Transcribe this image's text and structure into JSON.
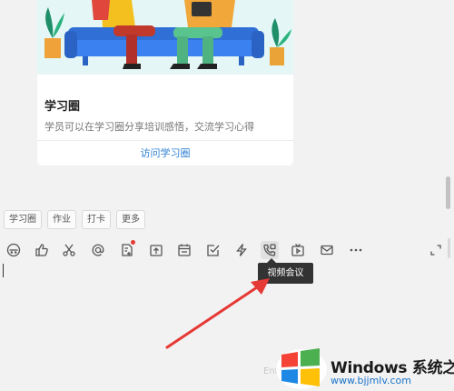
{
  "card": {
    "title": "学习圈",
    "description": "学员可以在学习圈分享培训感悟，交流学习心得",
    "link": "访问学习圈"
  },
  "tags": [
    "学习圈",
    "作业",
    "打卡",
    "更多"
  ],
  "toolbar": {
    "icons": [
      "robot-face-icon",
      "thumbs-up-icon",
      "scissors-icon",
      "at-sign-icon",
      "document-add-icon",
      "upload-box-icon",
      "calendar-icon",
      "checkbox-icon",
      "lightning-icon",
      "video-conference-icon",
      "live-video-icon",
      "mail-icon",
      "more-icon",
      "expand-icon"
    ],
    "active": "video-conference-icon",
    "notification_icon": "document-add-icon"
  },
  "tooltip": "视频会议",
  "annotation": {
    "arrow_color": "#e53935"
  },
  "watermark": {
    "brand": "Windows 系统之家",
    "url": "www.bjjmlv.com"
  },
  "colors": {
    "background": "#f2f2f2",
    "link": "#2f80d1",
    "notification": "#e53935",
    "illustration_bg": "#e4f7f6"
  }
}
